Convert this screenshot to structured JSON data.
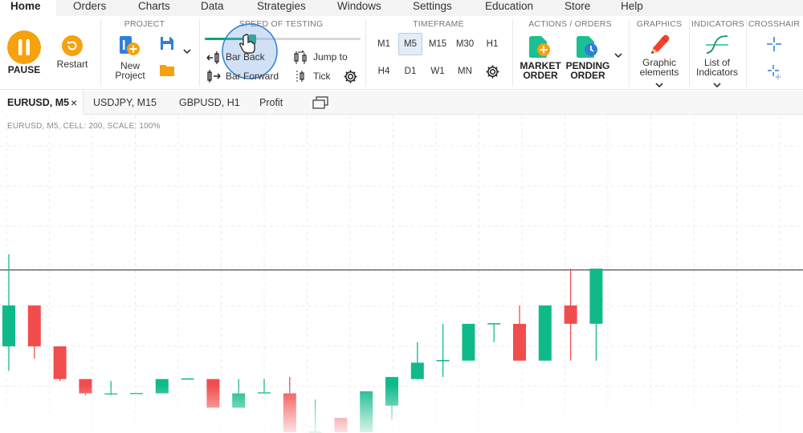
{
  "menu": {
    "items": [
      "Home",
      "Orders",
      "Charts",
      "Data",
      "Strategies",
      "Windows",
      "Settings",
      "Education",
      "Store",
      "Help"
    ],
    "active": "Home"
  },
  "ribbon": {
    "pause_label": "PAUSE",
    "restart_label": "Restart",
    "project": {
      "title": "PROJECT",
      "new_project_label_1": "New",
      "new_project_label_2": "Project"
    },
    "speed": {
      "title": "SPEED OF TESTING",
      "level": 0.31,
      "bar_back": "Bar Back",
      "bar_forward": "Bar Forward",
      "jump_to": "Jump to",
      "tick": "Tick"
    },
    "timeframe": {
      "title": "TIMEFRAME",
      "row1": [
        "M1",
        "M5",
        "M15",
        "M30",
        "H1"
      ],
      "row2": [
        "H4",
        "D1",
        "W1",
        "MN"
      ],
      "selected": "M5"
    },
    "actions": {
      "title": "ACTIONS  /  ORDERS",
      "market_1": "MARKET",
      "market_2": "ORDER",
      "pending_1": "PENDING",
      "pending_2": "ORDER"
    },
    "graphics": {
      "title": "GRAPHICS",
      "label_1": "Graphic",
      "label_2": "elements"
    },
    "indicators": {
      "title": "INDICATORS",
      "label_1": "List of",
      "label_2": "Indicators"
    },
    "crosshair": {
      "title": "CROSSHAIR"
    }
  },
  "tabs": {
    "items": [
      "EURUSD, M5",
      "USDJPY, M15",
      "GBPUSD, H1",
      "Profit"
    ],
    "active": "EURUSD, M5",
    "close_glyph": "×"
  },
  "chart_info": "EURUSD, M5, CELL: 200, SCALE: 100%",
  "colors": {
    "accent_orange": "#f5a20f",
    "bull": "#10b98a",
    "bear": "#f24d4d",
    "brand_teal": "#1bbf94",
    "speed_fill": "#0da57a",
    "selected_tf_bg": "#e3edf7"
  },
  "chart_data": {
    "type": "candlestick",
    "note_units": "price in chart-relative units (higher = up)",
    "ylim": [
      0,
      100
    ],
    "price_line": 79.3,
    "candles": [
      {
        "o": 42,
        "h": 87,
        "l": 30,
        "c": 62,
        "dir": "bull"
      },
      {
        "o": 62,
        "h": 62,
        "l": 36,
        "c": 42,
        "dir": "bear"
      },
      {
        "o": 42,
        "h": 42,
        "l": 25,
        "c": 26,
        "dir": "bear"
      },
      {
        "o": 26,
        "h": 26,
        "l": 18,
        "c": 19,
        "dir": "bear"
      },
      {
        "o": 19,
        "h": 25,
        "l": 18,
        "c": 19,
        "dir": "doji"
      },
      {
        "o": 19,
        "h": 19,
        "l": 19,
        "c": 19.2,
        "dir": "doji"
      },
      {
        "o": 19,
        "h": 26,
        "l": 19,
        "c": 26,
        "dir": "bull"
      },
      {
        "o": 26,
        "h": 26.3,
        "l": 26,
        "c": 26.3,
        "dir": "bull"
      },
      {
        "o": 26,
        "h": 26,
        "l": 12,
        "c": 12,
        "dir": "bear"
      },
      {
        "o": 12,
        "h": 26,
        "l": 12,
        "c": 19,
        "dir": "bull"
      },
      {
        "o": 19.5,
        "h": 26,
        "l": 19,
        "c": 19.5,
        "dir": "doji"
      },
      {
        "o": 19,
        "h": 27,
        "l": 0,
        "c": 0,
        "dir": "bear"
      },
      {
        "o": 0,
        "h": 16,
        "l": 0,
        "c": 0.3,
        "dir": "doji"
      },
      {
        "o": 7,
        "h": 7,
        "l": 0,
        "c": 0,
        "dir": "bear"
      },
      {
        "o": 0,
        "h": 20,
        "l": 0,
        "c": 20,
        "dir": "bull"
      },
      {
        "o": 13,
        "h": 27,
        "l": 6,
        "c": 27,
        "dir": "bull"
      },
      {
        "o": 26,
        "h": 44,
        "l": 26,
        "c": 34,
        "dir": "bull"
      },
      {
        "o": 35,
        "h": 53,
        "l": 27,
        "c": 35.3,
        "dir": "doji"
      },
      {
        "o": 35,
        "h": 53,
        "l": 35,
        "c": 53,
        "dir": "bull"
      },
      {
        "o": 53,
        "h": 53,
        "l": 44,
        "c": 53.3,
        "dir": "doji"
      },
      {
        "o": 53,
        "h": 62,
        "l": 35,
        "c": 35,
        "dir": "bear"
      },
      {
        "o": 35,
        "h": 62,
        "l": 35,
        "c": 62,
        "dir": "bull"
      },
      {
        "o": 62,
        "h": 80,
        "l": 35,
        "c": 53,
        "dir": "bear"
      },
      {
        "o": 53,
        "h": 80,
        "l": 35,
        "c": 80,
        "dir": "bull"
      }
    ]
  }
}
